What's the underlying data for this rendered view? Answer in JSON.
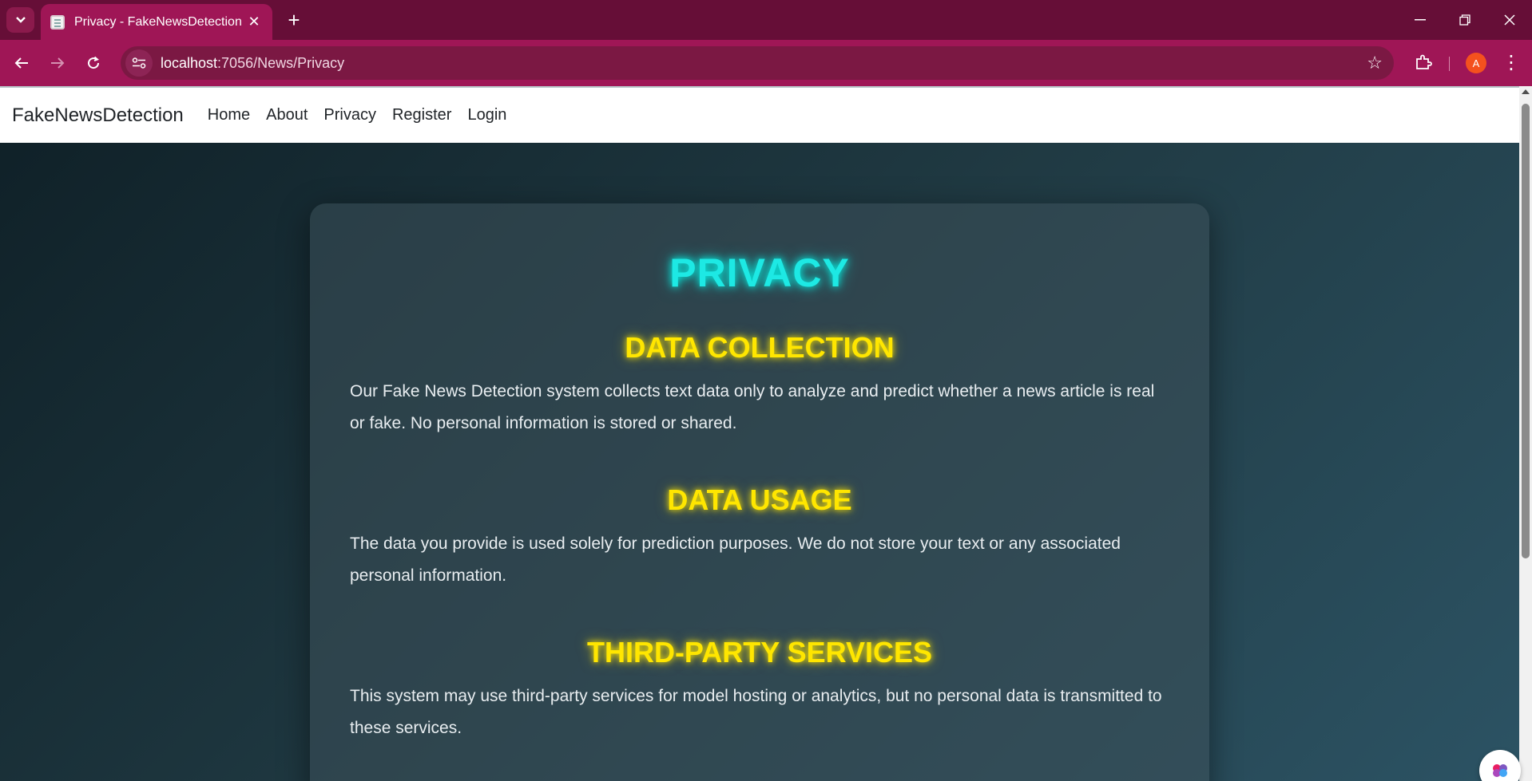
{
  "browser": {
    "tab_title": "Privacy - FakeNewsDetection",
    "url_host": "localhost",
    "url_path": ":7056/News/Privacy",
    "profile_initial": "A"
  },
  "site": {
    "brand": "FakeNewsDetection",
    "nav": [
      "Home",
      "About",
      "Privacy",
      "Register",
      "Login"
    ]
  },
  "content": {
    "title": "PRIVACY",
    "sections": [
      {
        "heading": "DATA COLLECTION",
        "text": "Our Fake News Detection system collects text data only to analyze and predict whether a news article is real or fake. No personal information is stored or shared."
      },
      {
        "heading": "DATA USAGE",
        "text": "The data you provide is used solely for prediction purposes. We do not store your text or any associated personal information."
      },
      {
        "heading": "THIRD-PARTY SERVICES",
        "text": "This system may use third-party services for model hosting or analytics, but no personal data is transmitted to these services."
      }
    ]
  },
  "colors": {
    "browser_frame": "#660e37",
    "browser_toolbar": "#9f1656",
    "title_glow": "#1de9e4",
    "heading_glow": "#ffe600"
  },
  "icons": {
    "tab_list": "chevron-down-icon",
    "back": "back-arrow-icon",
    "forward": "forward-arrow-icon",
    "reload": "reload-icon",
    "site_info": "site-info-icon",
    "bookmark": "star-icon",
    "extensions": "puzzle-icon",
    "menu": "more-vert-icon"
  }
}
